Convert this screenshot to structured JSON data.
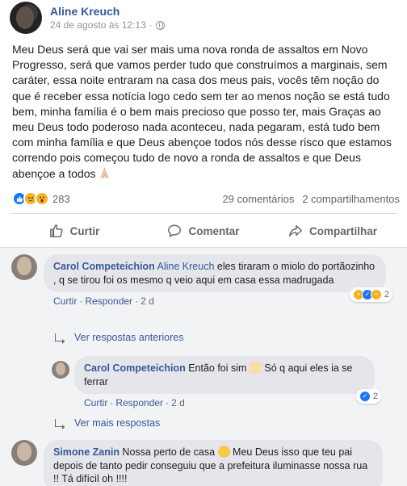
{
  "post": {
    "author": "Aline Kreuch",
    "timestamp": "24 de agosto às 12:13",
    "dot": "·",
    "text": "Meu Deus será que vai ser mais uma nova ronda de assaltos em Novo Progresso, será que vamos perder tudo que construímos a marginais, sem caráter, essa noite entraram na casa dos meus pais, vocês têm noção do que é receber essa notícia logo cedo sem ter ao menos noção se está tudo bem, minha família é o bem mais precioso que posso ter, mais Graças ao meu Deus todo poderoso nada aconteceu, nada pegaram, está tudo bem com minha família e que Deus abençoe todos nós desse risco que estamos correndo pois começou tudo de novo a ronda de assaltos e que Deus abençoe a todos",
    "reaction_count": "283",
    "comments_count": "29 comentários",
    "shares_count": "2 compartilhamentos"
  },
  "actions": {
    "like": "Curtir",
    "comment": "Comentar",
    "share": "Compartilhar"
  },
  "comments": [
    {
      "name": "Carol Competeichion",
      "tag": "Aline Kreuch",
      "text": " eles tiraram o miolo do portãozinho , q se tirou foi os mesmo q veio aqui em casa essa madrugada",
      "like": "Curtir",
      "reply": "Responder",
      "time": "2 d",
      "reactions": "2"
    },
    {
      "name": "Carol Competeichion",
      "text_before": " Então foi sim ",
      "text_after": " Só q aqui eles ia se ferrar",
      "like": "Curtir",
      "reply": "Responder",
      "time": "2 d",
      "reactions": "2"
    },
    {
      "name": "Simone Zanin",
      "text_before": " Nossa perto de casa ",
      "text_after": " Meu Deus isso que teu pai depois de tanto pedir conseguiu que a prefeitura iluminasse nossa rua !! Tá difícil oh !!!!"
    }
  ],
  "links": {
    "previous_replies": "Ver respostas anteriores",
    "more_replies": "Ver mais respostas"
  },
  "colors": {
    "link_blue": "#385898",
    "like_blue": "#1877f2",
    "emoji_yellow": "#f7b125"
  }
}
